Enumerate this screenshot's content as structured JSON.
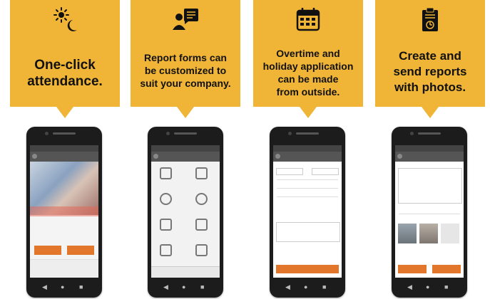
{
  "features": [
    {
      "icon": "sun-moon-icon",
      "lines": "One-click\nattendance."
    },
    {
      "icon": "report-chat-icon",
      "lines": "Report forms can\nbe customized to\nsuit your company."
    },
    {
      "icon": "calendar-icon",
      "lines": "Overtime and\nholiday application\ncan be made\nfrom outside."
    },
    {
      "icon": "clipboard-report-icon",
      "lines": "Create and\nsend reports\nwith photos."
    }
  ],
  "colors": {
    "accent": "#f0b436",
    "button": "#e2772c",
    "phone": "#1c1c1c"
  }
}
